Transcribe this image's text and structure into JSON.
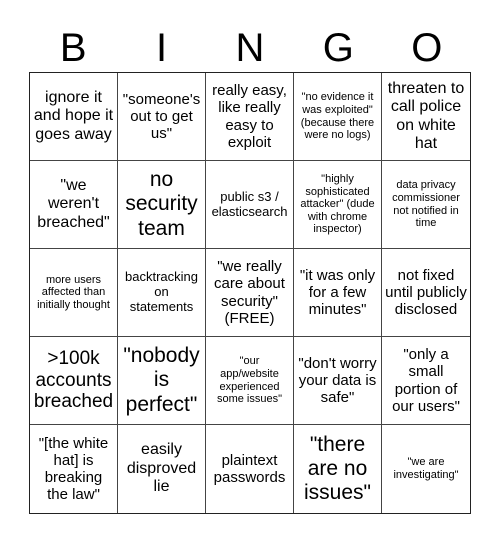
{
  "header": {
    "letters": [
      "B",
      "I",
      "N",
      "G",
      "O"
    ]
  },
  "board": {
    "rows": [
      [
        "ignore it and hope it goes away",
        "\"someone's out to get us\"",
        "really easy, like really easy to exploit",
        "\"no evidence it was exploited\" (because there were no logs)",
        "threaten to call police on white hat"
      ],
      [
        "\"we weren't breached\"",
        "no security team",
        "public s3 / elasticsearch",
        "\"highly sophisticated attacker\" (dude with chrome inspector)",
        "data privacy commissioner not notified in time"
      ],
      [
        "more users affected than initially thought",
        "backtracking on statements",
        "\"we really care about security\" (FREE)",
        "\"it was only for a few minutes\"",
        "not fixed until publicly disclosed"
      ],
      [
        ">100k accounts breached",
        "\"nobody is perfect\"",
        "\"our app/website experienced some issues\"",
        "\"don't worry your data is safe\"",
        "\"only a small portion of our users\""
      ],
      [
        "\"[the white hat] is breaking the law\"",
        "easily disproved lie",
        "plaintext passwords",
        "\"there are no issues\"",
        "\"we are investigating\""
      ]
    ]
  }
}
